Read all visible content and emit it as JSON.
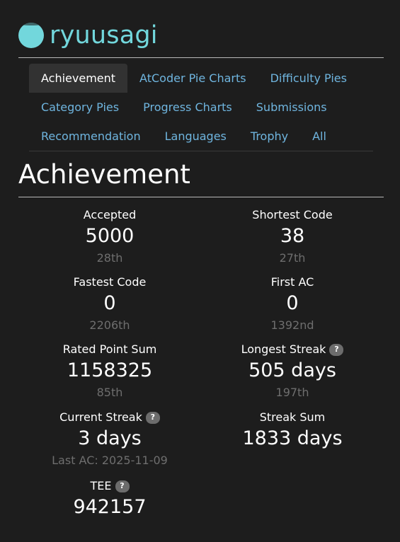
{
  "user": {
    "name": "ryuusagi",
    "icon_color": "#72d7dc"
  },
  "tabs": [
    [
      "Achievement",
      "AtCoder Pie Charts",
      "Difficulty Pies"
    ],
    [
      "Category Pies",
      "Progress Charts",
      "Submissions"
    ],
    [
      "Recommendation",
      "Languages",
      "Trophy",
      "All"
    ]
  ],
  "active_tab": "Achievement",
  "section_title": "Achievement",
  "achievements": {
    "accepted": {
      "label": "Accepted",
      "value": "5000",
      "sub": "28th"
    },
    "shortest_code": {
      "label": "Shortest Code",
      "value": "38",
      "sub": "27th"
    },
    "fastest_code": {
      "label": "Fastest Code",
      "value": "0",
      "sub": "2206th"
    },
    "first_ac": {
      "label": "First AC",
      "value": "0",
      "sub": "1392nd"
    },
    "rated_point_sum": {
      "label": "Rated Point Sum",
      "value": "1158325",
      "sub": "85th"
    },
    "longest_streak": {
      "label": "Longest Streak",
      "value": "505 days",
      "sub": "197th",
      "help": "?"
    },
    "current_streak": {
      "label": "Current Streak",
      "value": "3 days",
      "sub": "Last AC: 2025-11-09",
      "help": "?"
    },
    "streak_sum": {
      "label": "Streak Sum",
      "value": "1833 days"
    },
    "tee": {
      "label": "TEE",
      "value": "942157",
      "help": "?"
    }
  }
}
